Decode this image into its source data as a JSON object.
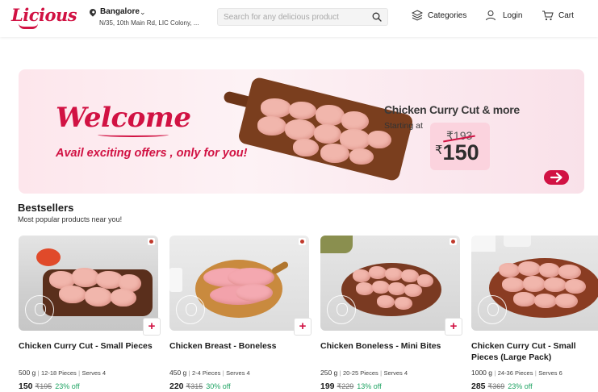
{
  "header": {
    "logo": "Licious",
    "location": {
      "city": "Bangalore",
      "address": "N/35, 10th Main Rd, LIC Colony, ..."
    },
    "search_placeholder": "Search for any delicious product",
    "nav": {
      "categories": "Categories",
      "login": "Login",
      "cart": "Cart"
    }
  },
  "banner": {
    "welcome": "Welcome",
    "tagline": "Avail exciting offers , only for you!",
    "offer_title": "Chicken Curry Cut & more",
    "offer_starting": "Starting at",
    "old_price": "₹193",
    "currency": "₹",
    "new_price": "150"
  },
  "bestsellers": {
    "title": "Bestsellers",
    "subtitle": "Most popular products near you!",
    "products": [
      {
        "name": "Chicken Curry Cut - Small Pieces",
        "weight": "500 g",
        "pieces": "12-18 Pieces",
        "serves": "Serves 4",
        "price": "150",
        "mrp": "₹195",
        "discount": "23% off"
      },
      {
        "name": "Chicken Breast - Boneless",
        "weight": "450 g",
        "pieces": "2-4 Pieces",
        "serves": "Serves 4",
        "price": "220",
        "mrp": "₹315",
        "discount": "30% off"
      },
      {
        "name": "Chicken Boneless - Mini Bites",
        "weight": "250 g",
        "pieces": "20-25 Pieces",
        "serves": "Serves 4",
        "price": "199",
        "mrp": "₹229",
        "discount": "13% off"
      },
      {
        "name": "Chicken Curry Cut - Small Pieces (Large Pack)",
        "weight": "1000 g",
        "pieces": "24-36 Pieces",
        "serves": "Serves 6",
        "price": "285",
        "mrp": "₹369",
        "discount": "23% off"
      }
    ],
    "add_label": "+"
  },
  "colors": {
    "brand": "#d11243",
    "discount": "#1fa463",
    "banner_bg": "#fde6ec"
  },
  "icons": [
    "location-pin-icon",
    "chevron-down-icon",
    "search-icon",
    "categories-icon",
    "user-icon",
    "cart-icon",
    "arrow-right-icon"
  ]
}
